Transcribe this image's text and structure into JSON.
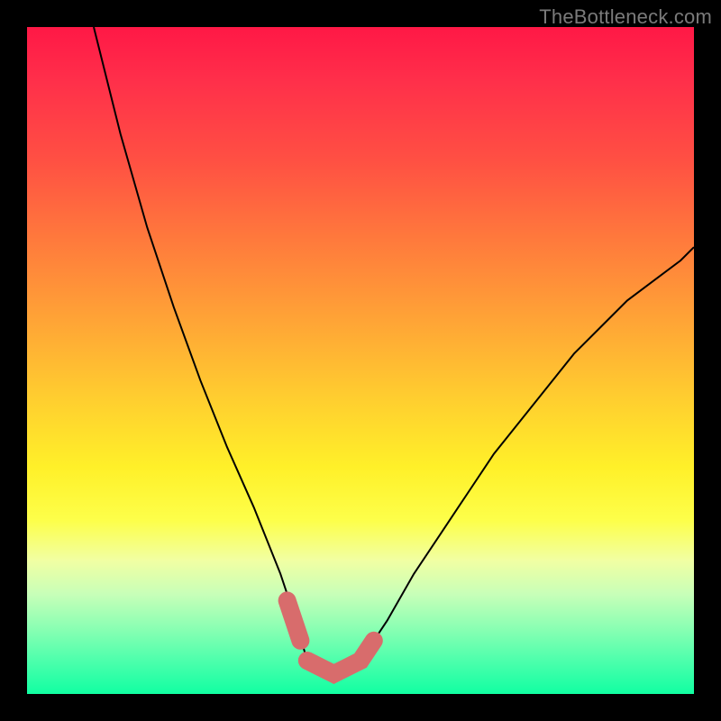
{
  "watermark": "TheBottleneck.com",
  "colors": {
    "curve_stroke": "#000000",
    "thick_seg_stroke": "#d86c6c",
    "gradient_top": "#ff1846",
    "gradient_mid": "#fff029",
    "gradient_bottom": "#11ffa2",
    "background": "#000000"
  },
  "chart_data": {
    "type": "line",
    "title": "",
    "xlabel": "",
    "ylabel": "",
    "xlim": [
      0,
      100
    ],
    "ylim": [
      0,
      100
    ],
    "grid": false,
    "legend": false,
    "series": [
      {
        "name": "left_branch",
        "x": [
          10,
          14,
          18,
          22,
          26,
          30,
          34,
          38,
          40,
          42
        ],
        "y": [
          100,
          84,
          70,
          58,
          47,
          37,
          28,
          18,
          12,
          5
        ]
      },
      {
        "name": "right_branch",
        "x": [
          50,
          54,
          58,
          62,
          66,
          70,
          74,
          78,
          82,
          86,
          90,
          94,
          98,
          100
        ],
        "y": [
          5,
          11,
          18,
          24,
          30,
          36,
          41,
          46,
          51,
          55,
          59,
          62,
          65,
          67
        ]
      },
      {
        "name": "valley_floor",
        "x": [
          42,
          46,
          50
        ],
        "y": [
          5,
          3,
          5
        ]
      },
      {
        "name": "highlight_left_tip",
        "x": [
          39,
          41
        ],
        "y": [
          14,
          8
        ]
      },
      {
        "name": "highlight_valley",
        "x": [
          42,
          46,
          50,
          52
        ],
        "y": [
          5,
          3,
          5,
          8
        ]
      }
    ],
    "annotations": []
  }
}
